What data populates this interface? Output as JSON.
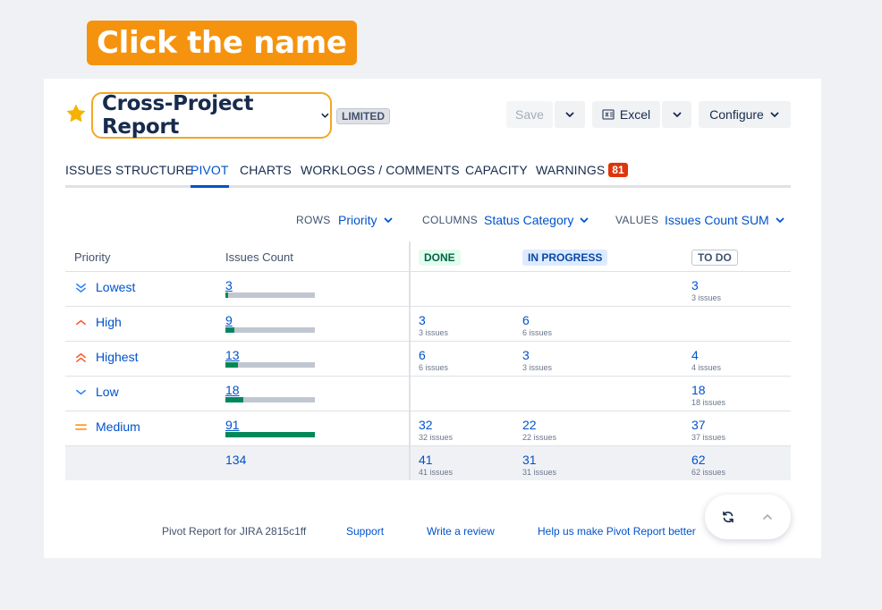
{
  "callout": "Click the name",
  "report": {
    "title": "Cross-Project Report",
    "badge": "LIMITED"
  },
  "toolbar": {
    "save": "Save",
    "excel": "Excel",
    "configure": "Configure"
  },
  "tabs": [
    {
      "label": "ISSUES STRUCTURE"
    },
    {
      "label": "PIVOT",
      "active": true
    },
    {
      "label": "CHARTS"
    },
    {
      "label": "WORKLOGS / COMMENTS"
    },
    {
      "label": "CAPACITY"
    },
    {
      "label": "WARNINGS",
      "badge": "81"
    }
  ],
  "selectors": {
    "rows": {
      "label": "ROWS",
      "value": "Priority"
    },
    "columns": {
      "label": "COLUMNS",
      "value": "Status Category"
    },
    "values": {
      "label": "VALUES",
      "value": "Issues Count SUM"
    }
  },
  "table": {
    "headers": {
      "priority": "Priority",
      "count": "Issues Count"
    },
    "status_columns": [
      "DONE",
      "IN PROGRESS",
      "TO DO"
    ],
    "rows": [
      {
        "priority": "Lowest",
        "count": "3",
        "fill": 0.033,
        "done": "",
        "done_sub": "",
        "inprog": "",
        "inprog_sub": "",
        "todo": "3",
        "todo_sub": "3 issues"
      },
      {
        "priority": "High",
        "count": "9",
        "fill": 0.099,
        "done": "3",
        "done_sub": "3 issues",
        "inprog": "6",
        "inprog_sub": "6 issues",
        "todo": "",
        "todo_sub": ""
      },
      {
        "priority": "Highest",
        "count": "13",
        "fill": 0.143,
        "done": "6",
        "done_sub": "6 issues",
        "inprog": "3",
        "inprog_sub": "3 issues",
        "todo": "4",
        "todo_sub": "4 issues"
      },
      {
        "priority": "Low",
        "count": "18",
        "fill": 0.198,
        "done": "",
        "done_sub": "",
        "inprog": "",
        "inprog_sub": "",
        "todo": "18",
        "todo_sub": "18 issues"
      },
      {
        "priority": "Medium",
        "count": "91",
        "fill": 1.0,
        "done": "32",
        "done_sub": "32 issues",
        "inprog": "22",
        "inprog_sub": "22 issues",
        "todo": "37",
        "todo_sub": "37 issues"
      }
    ],
    "totals": {
      "count": "134",
      "done": "41",
      "done_sub": "41 issues",
      "inprog": "31",
      "inprog_sub": "31 issues",
      "todo": "62",
      "todo_sub": "62 issues"
    }
  },
  "footer": {
    "version": "Pivot Report for JIRA 2815c1ff",
    "support": "Support",
    "review": "Write a review",
    "help": "Help us make Pivot Report better"
  },
  "colors": {
    "accent": "#0052cc",
    "callout": "#f5930e",
    "bar_fill": "#00875a",
    "done_bg": "#e3fcef",
    "inprog_bg": "#deebff",
    "warning_badge": "#de350b"
  },
  "icons": [
    "star-icon",
    "chevron-down-icon",
    "excel-icon",
    "priority-lowest-icon",
    "priority-high-icon",
    "priority-highest-icon",
    "priority-low-icon",
    "priority-medium-icon",
    "refresh-icon",
    "chevron-up-icon"
  ]
}
